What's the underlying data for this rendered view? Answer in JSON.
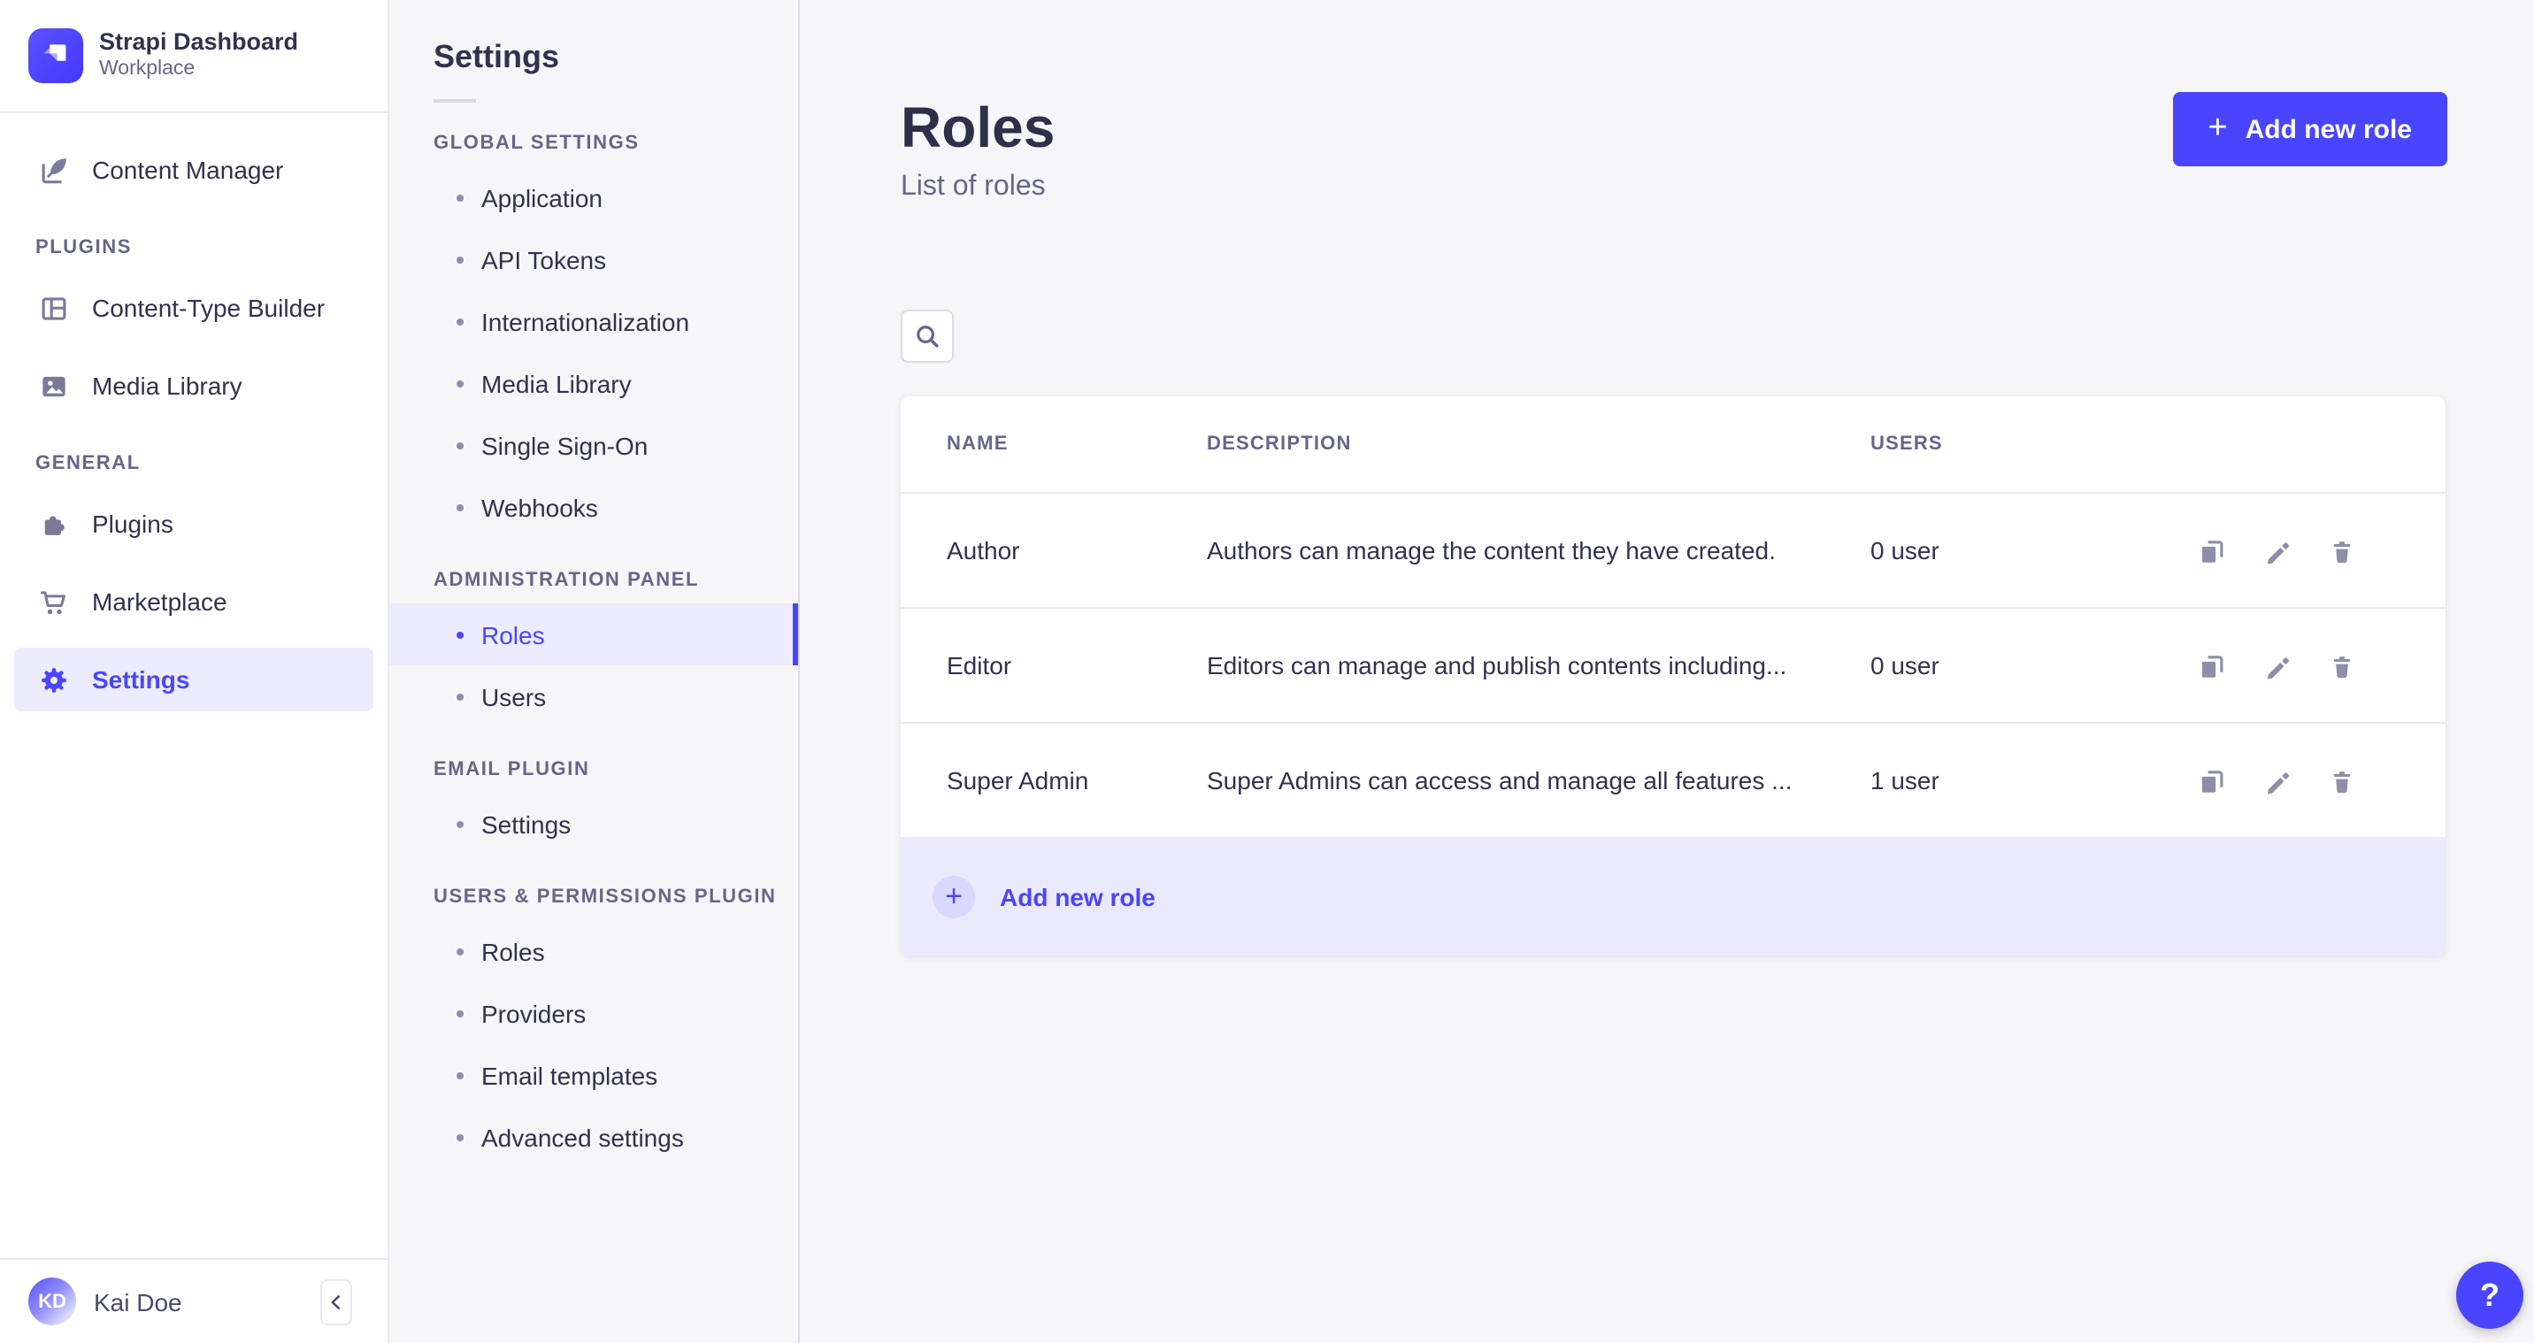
{
  "brand": {
    "title": "Strapi Dashboard",
    "subtitle": "Workplace"
  },
  "sidebar": {
    "content_manager": "Content Manager",
    "sections": [
      {
        "label": "PLUGINS",
        "items": [
          "Content-Type Builder",
          "Media Library"
        ]
      },
      {
        "label": "GENERAL",
        "items": [
          "Plugins",
          "Marketplace",
          "Settings"
        ]
      }
    ],
    "active_item": "Settings",
    "user": {
      "initials": "KD",
      "name": "Kai Doe"
    }
  },
  "subnav": {
    "title": "Settings",
    "sections": [
      {
        "label": "GLOBAL SETTINGS",
        "items": [
          "Application",
          "API Tokens",
          "Internationalization",
          "Media Library",
          "Single Sign-On",
          "Webhooks"
        ]
      },
      {
        "label": "ADMINISTRATION PANEL",
        "items": [
          "Roles",
          "Users"
        ]
      },
      {
        "label": "EMAIL PLUGIN",
        "items": [
          "Settings"
        ]
      },
      {
        "label": "USERS & PERMISSIONS PLUGIN",
        "items": [
          "Roles",
          "Providers",
          "Email templates",
          "Advanced settings"
        ]
      }
    ],
    "active_item": "Roles"
  },
  "main": {
    "title": "Roles",
    "subtitle": "List of roles",
    "add_button_label": "Add new role",
    "table": {
      "columns": [
        "NAME",
        "DESCRIPTION",
        "USERS"
      ],
      "rows": [
        {
          "name": "Author",
          "description": "Authors can manage the content they have created.",
          "users": "0 user"
        },
        {
          "name": "Editor",
          "description": "Editors can manage and publish contents including...",
          "users": "0 user"
        },
        {
          "name": "Super Admin",
          "description": "Super Admins can access and manage all features ...",
          "users": "1 user"
        }
      ],
      "footer_add_label": "Add new role"
    }
  },
  "icons": {
    "plus": "+",
    "help": "?",
    "collapse": "chevron-left",
    "search": "magnifier",
    "row_actions": [
      "duplicate",
      "edit",
      "delete"
    ]
  },
  "colors": {
    "primary": "#4945ff",
    "primary_active_bg": "#ececfe",
    "footer_band": "#eaeafc",
    "plus_circle": "#d9d8ff",
    "text": "#32324d",
    "text_secondary": "#666687",
    "icon_gray": "#8e8ea9",
    "border": "#eaeaef",
    "background": "#f6f6f9",
    "surface": "#ffffff"
  }
}
